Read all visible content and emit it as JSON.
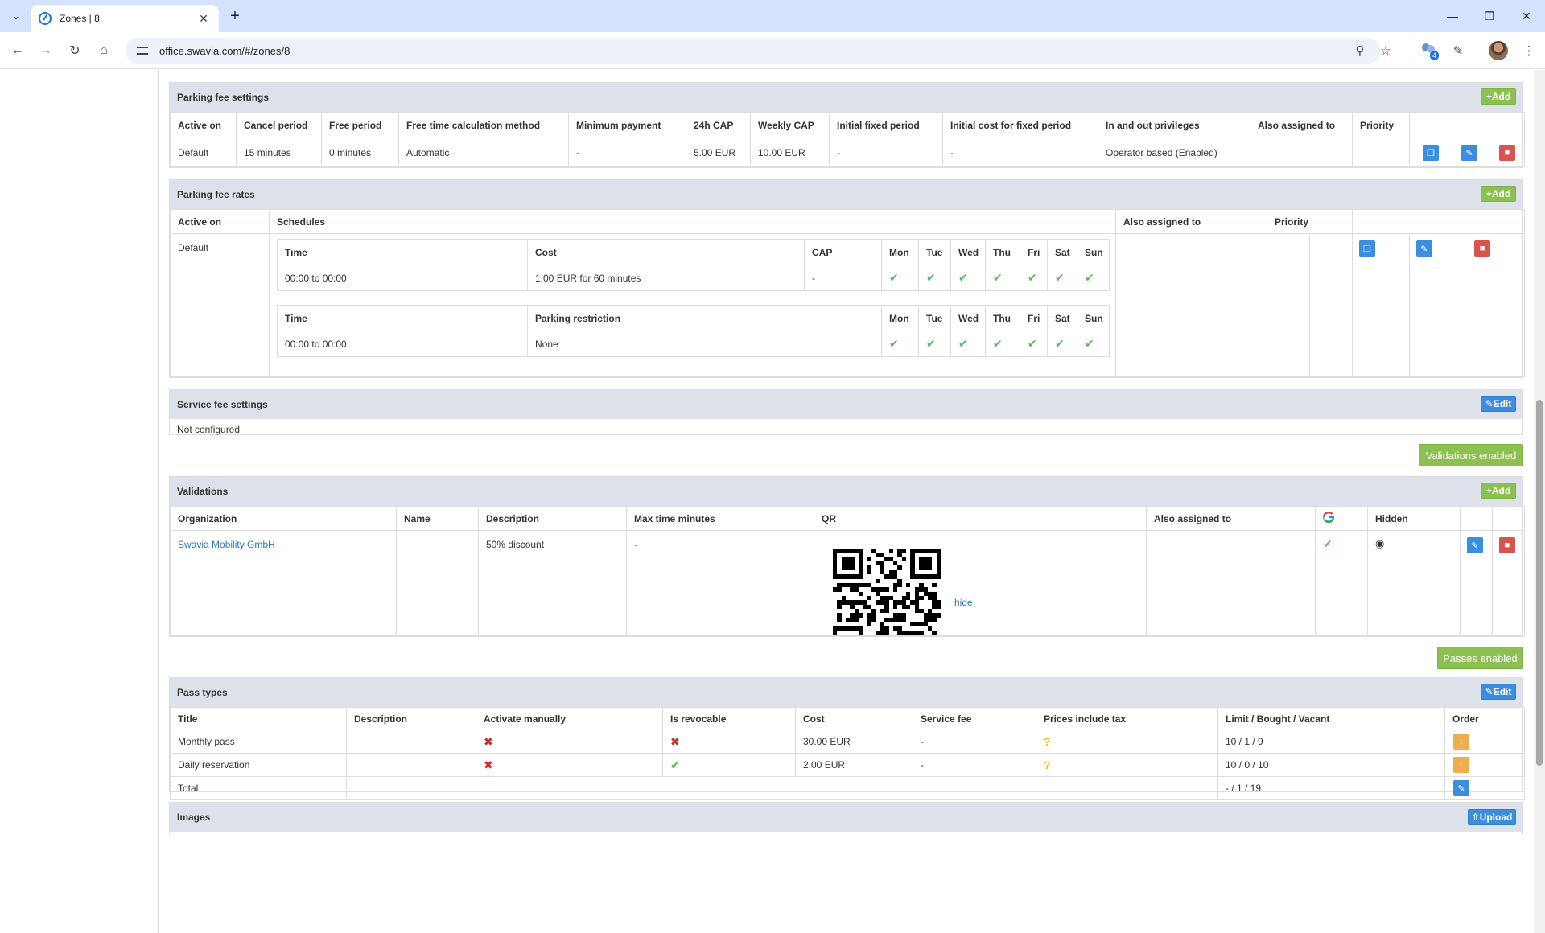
{
  "browser": {
    "tab_title": "Zones | 8",
    "url": "office.swavia.com/#/zones/8",
    "extension_badge": "4"
  },
  "colors": {
    "green": "#8cc152",
    "blue": "#3b8de0",
    "red": "#d9534f",
    "header_bg": "#dde2ea"
  },
  "add_label": "Add",
  "edit_label": "Edit",
  "parking_fee_settings": {
    "title": "Parking fee settings",
    "headers": [
      "Active on",
      "Cancel period",
      "Free period",
      "Free time calculation method",
      "Minimum payment",
      "24h CAP",
      "Weekly CAP",
      "Initial fixed period",
      "Initial cost for fixed period",
      "In and out privileges",
      "Also assigned to",
      "Priority"
    ],
    "row": [
      "Default",
      "15 minutes",
      "0 minutes",
      "Automatic",
      "-",
      "5.00 EUR",
      "10.00 EUR",
      "-",
      "-",
      "Operator based (Enabled)",
      "",
      ""
    ]
  },
  "parking_fee_rates": {
    "title": "Parking fee rates",
    "headers": {
      "active_on": "Active on",
      "schedules": "Schedules",
      "also_assigned": "Also assigned to",
      "priority": "Priority"
    },
    "active_on": "Default",
    "cost_table": {
      "headers": [
        "Time",
        "Cost",
        "CAP",
        "Mon",
        "Tue",
        "Wed",
        "Thu",
        "Fri",
        "Sat",
        "Sun"
      ],
      "row": {
        "time": "00:00 to 00:00",
        "cost": "1.00 EUR for 60 minutes",
        "cap": "-"
      }
    },
    "restriction_table": {
      "headers": [
        "Time",
        "Parking restriction",
        "Mon",
        "Tue",
        "Wed",
        "Thu",
        "Fri",
        "Sat",
        "Sun"
      ],
      "row": {
        "time": "00:00 to 00:00",
        "restriction": "None"
      }
    }
  },
  "service_fee_settings": {
    "title": "Service fee settings",
    "body": "Not configured"
  },
  "validations_enabled_label": "Validations enabled",
  "validations": {
    "title": "Validations",
    "headers": [
      "Organization",
      "Name",
      "Description",
      "Max time minutes",
      "QR",
      "Also assigned to",
      "",
      "Hidden"
    ],
    "row": {
      "organization": "Swavia Mobility GmbH",
      "name": "",
      "description": "50% discount",
      "max_time": "-",
      "qr_toggle": "hide"
    }
  },
  "passes_enabled_label": "Passes enabled",
  "pass_types": {
    "title": "Pass types",
    "headers": [
      "Title",
      "Description",
      "Activate manually",
      "Is revocable",
      "Cost",
      "Service fee",
      "Prices include tax",
      "Limit / Bought / Vacant",
      "Order"
    ],
    "rows": [
      {
        "title": "Monthly pass",
        "cost": "30.00 EUR",
        "service_fee": "-",
        "limit": "10 / 1 / 9"
      },
      {
        "title": "Daily reservation",
        "cost": "2.00 EUR",
        "service_fee": "-",
        "limit": "10 / 0 / 10"
      }
    ],
    "total": {
      "label": "Total",
      "limit": "- / 1 / 19"
    }
  },
  "images": {
    "title": "Images",
    "upload_label": "Upload"
  }
}
